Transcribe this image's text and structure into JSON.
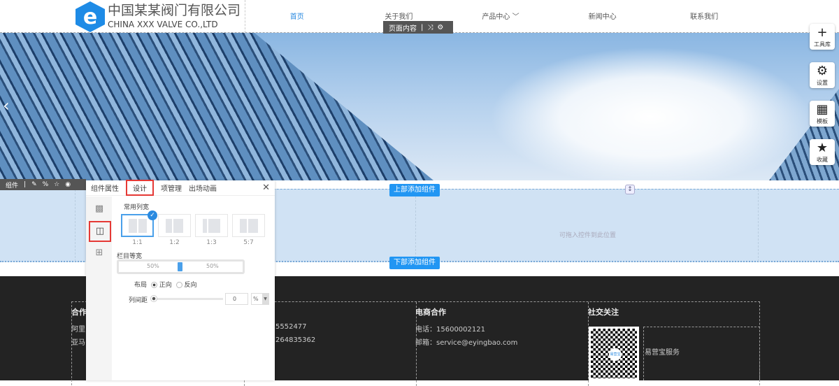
{
  "header": {
    "logo_letter": "e",
    "company_cn": "中国某某阀门有限公司",
    "company_en": "CHINA XXX VALVE CO.,LTD",
    "nav": [
      "首页",
      "关于我们",
      "产品中心 ﹀",
      "新闻中心",
      "联系我们"
    ],
    "page_content_label": "页面内容"
  },
  "hero": {
    "prev_icon": "‹"
  },
  "toolbar": [
    {
      "icon": "+",
      "label": "工具库"
    },
    {
      "icon": "⚙",
      "label": "设置"
    },
    {
      "icon": "▦",
      "label": "模板"
    },
    {
      "icon": "★",
      "label": "收藏"
    }
  ],
  "section": {
    "add_top": "上部添加组件",
    "add_bottom": "下部添加组件",
    "drop_placeholder": "可拖入控件到此位置",
    "component_label": "组件"
  },
  "panel": {
    "tabs": [
      "组件属性",
      "设计",
      "项管理",
      "出场动画"
    ],
    "close": "✕",
    "common_widths_label": "常用列宽",
    "ratios": [
      "1:1",
      "1:2",
      "1:3",
      "5:7"
    ],
    "equal_width_label": "栏目等宽",
    "left_pct": "50%",
    "right_pct": "50%",
    "layout_label": "布局",
    "layout_options": [
      "正向",
      "反向"
    ],
    "gap_label": "列间距",
    "gap_value": "0",
    "gap_unit": "%"
  },
  "footer": {
    "col1_title": "合作",
    "col1_lines": [
      "阿里",
      "亚马"
    ],
    "col2_lines": [
      "5552477",
      "264835362"
    ],
    "col3_title": "电商合作",
    "col3_lines": [
      "电话：15600002121",
      "邮箱：service@eyingbao.com"
    ],
    "col4_title": "社交关注",
    "qr_logo": "易营宝",
    "qr_caption": "易营宝服务"
  }
}
